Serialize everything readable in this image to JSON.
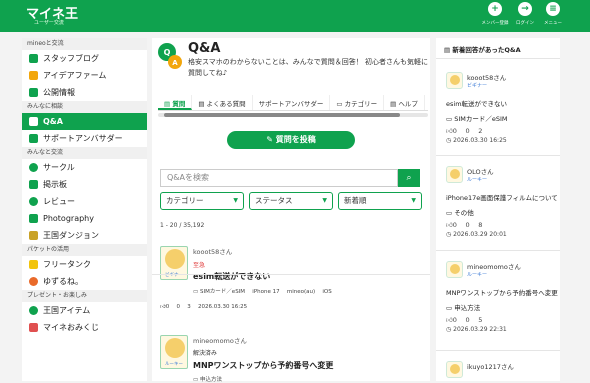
{
  "header": {
    "logo": "マイネ王",
    "logo_sub": "ユーザー交流",
    "buttons": [
      {
        "label": "メンバー登録",
        "icon": "person-add-icon"
      },
      {
        "label": "ログイン",
        "icon": "login-icon"
      },
      {
        "label": "メニュー",
        "icon": "menu-icon"
      }
    ]
  },
  "sidebar": {
    "sections": [
      {
        "title": "mineoと交流",
        "items": [
          {
            "label": "スタッフブログ",
            "icon": "blog-icon",
            "color": "#0fa24e"
          },
          {
            "label": "アイデアファーム",
            "icon": "idea-icon",
            "color": "#f2a60c"
          },
          {
            "label": "公開情報",
            "icon": "chart-icon",
            "color": "#0fa24e"
          }
        ]
      },
      {
        "title": "みんなに相談",
        "items": [
          {
            "label": "Q&A",
            "icon": "qa-icon",
            "color": "#ffffff",
            "active": true
          },
          {
            "label": "サポートアンバサダー",
            "icon": "support-icon",
            "color": "#0fa24e"
          }
        ]
      },
      {
        "title": "みんなと交流",
        "items": [
          {
            "label": "サークル",
            "icon": "circle-icon",
            "color": "#0fa24e"
          },
          {
            "label": "掲示板",
            "icon": "board-icon",
            "color": "#0fa24e"
          },
          {
            "label": "レビュー",
            "icon": "review-icon",
            "color": "#0fa24e"
          },
          {
            "label": "Photography",
            "icon": "camera-icon",
            "color": "#0fa24e"
          },
          {
            "label": "王国ダンジョン",
            "icon": "dungeon-icon",
            "color": "#c9a227"
          }
        ]
      },
      {
        "title": "パケットの活用",
        "items": [
          {
            "label": "フリータンク",
            "icon": "tank-icon",
            "color": "#f2c40c"
          },
          {
            "label": "ゆずるね。",
            "icon": "yuzurune-icon",
            "color": "#e96a2a"
          }
        ]
      },
      {
        "title": "プレゼント・お楽しみ",
        "items": [
          {
            "label": "王国アイテム",
            "icon": "item-icon",
            "color": "#0fa24e"
          },
          {
            "label": "マイネおみくじ",
            "icon": "omikuji-icon",
            "color": "#e05050"
          }
        ]
      }
    ]
  },
  "main": {
    "title": "Q&A",
    "intro": "格安スマホのわからないことは、みんなで質問＆回答！ 初心者さんも気軽に質問してね♪",
    "tabs": [
      "質問",
      "よくある質問",
      "サポートアンバサダー",
      "カテゴリー",
      "ヘルプ"
    ],
    "post_button": "質問を投稿",
    "search_placeholder": "Q&Aを検索",
    "filters": [
      "カテゴリー",
      "ステータス",
      "新着順"
    ],
    "count_text": "1 - 20 / 35,192",
    "posts": [
      {
        "user": "kooot58さん",
        "rank": "ビギナー",
        "tag": "至急",
        "tag_color": "#e03b3b",
        "title": "esim転送ができない",
        "cats": "SIMカード／eSIM　 iPhone 17　 mineo(au)　 iOS",
        "stats": "0　 0　 3　 2026.03.30 16:25"
      },
      {
        "user": "mineomomoさん",
        "rank": "ルーキー",
        "tag": "解決済み",
        "tag_color": "#333333",
        "title": "MNPワンストップから予約番号へ変更",
        "cats": "申込方法",
        "stats": ""
      }
    ]
  },
  "right": {
    "heading": "新着回答があったQ&A",
    "items": [
      {
        "user": "kooot58さん",
        "rank": "ビギナー",
        "question": "esim転送ができない",
        "category": "SIMカード／eSIM",
        "stats": "0　 0　 2",
        "date": "2026.03.30 16:25"
      },
      {
        "user": "OLOさん",
        "rank": "ルーキー",
        "question": "iPhone17e画面保護フィルムについて",
        "category": "その他",
        "stats": "0　 0　 8",
        "date": "2026.03.29 20:01"
      },
      {
        "user": "mineomomoさん",
        "rank": "ルーキー",
        "question": "MNPワンストップから予約番号へ変更",
        "category": "申込方法",
        "stats": "0　 0　 5",
        "date": "2026.03.29 22:31"
      },
      {
        "user": "ikuyo1217さん",
        "rank": "",
        "question": "",
        "category": "",
        "stats": "",
        "date": ""
      }
    ]
  }
}
